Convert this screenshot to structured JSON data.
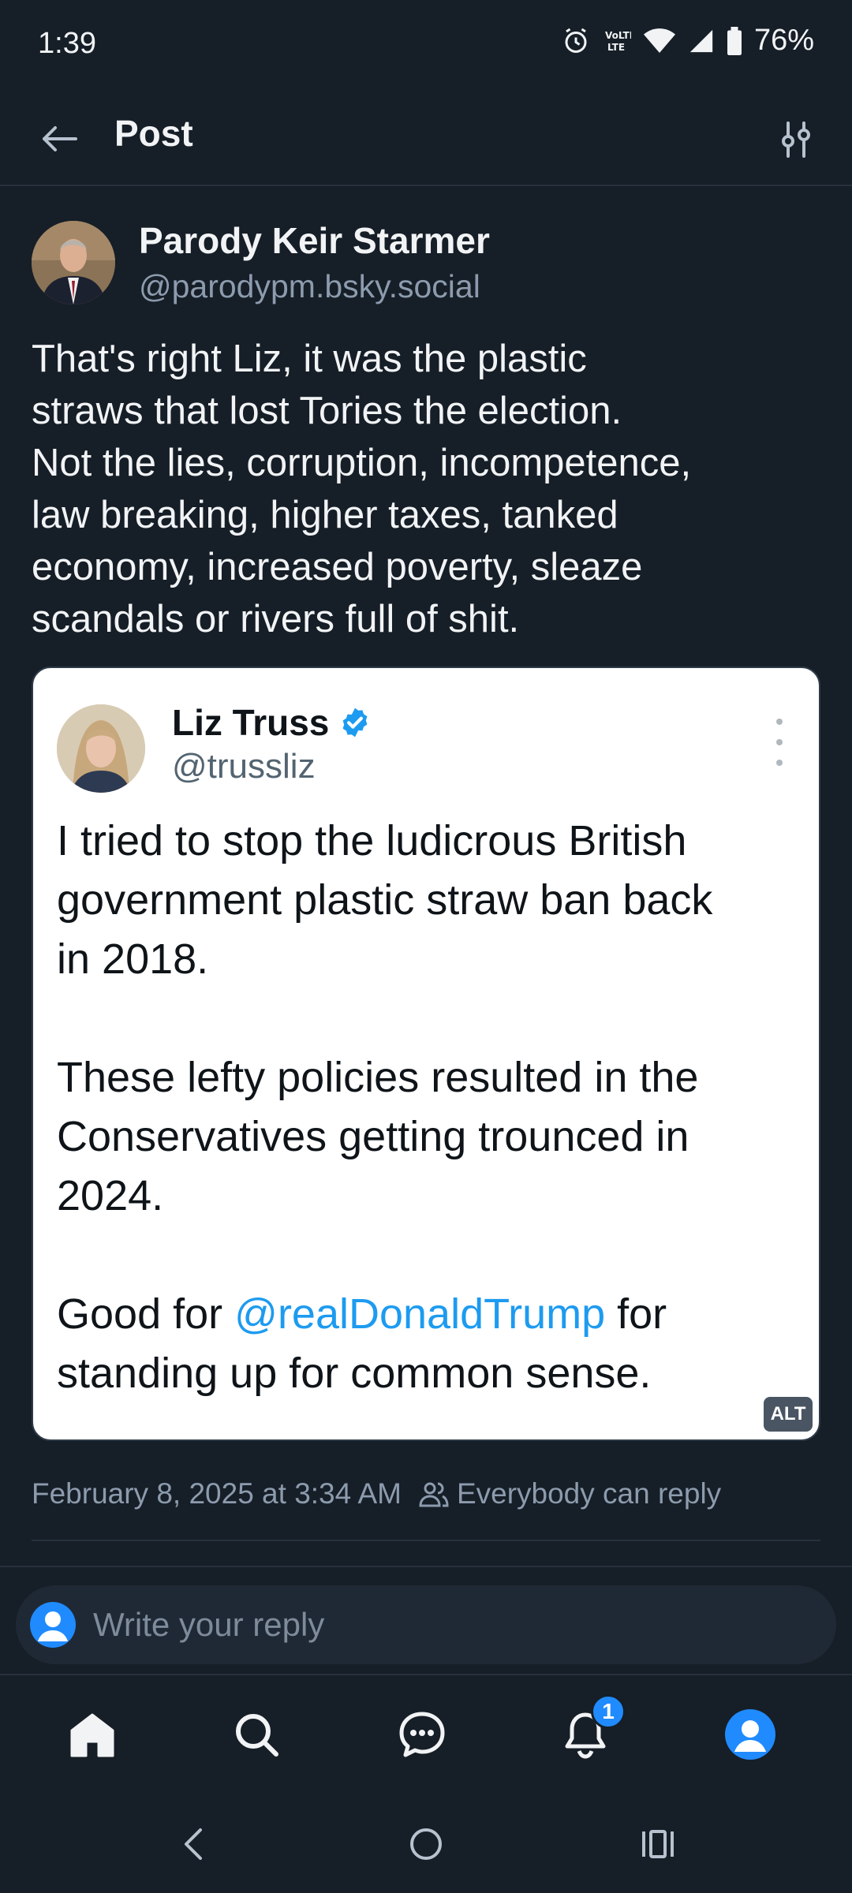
{
  "status_bar": {
    "time": "1:39",
    "battery": "76%"
  },
  "header": {
    "title": "Post"
  },
  "post": {
    "author_name": "Parody Keir Starmer",
    "author_handle": "@parodypm.bsky.social",
    "text_lines": [
      "That's right Liz, it was the plastic",
      "straws that lost Tories the election.",
      "Not the lies, corruption, incompetence,",
      "law breaking, higher taxes, tanked",
      "economy, increased poverty, sleaze",
      "scandals or rivers full of shit."
    ],
    "timestamp": "February 8, 2025 at 3:34 AM",
    "reply_setting": "Everybody can reply"
  },
  "embed": {
    "name": "Liz Truss",
    "handle": "@trussliz",
    "para1": [
      "I tried to stop the ludicrous British",
      "government plastic straw ban back",
      "in 2018."
    ],
    "para2": [
      "These lefty policies resulted in the",
      "Conservatives getting trounced in",
      "2024."
    ],
    "para3_prefix": "Good for ",
    "para3_mention": "@realDonaldTrump",
    "para3_suffix": " for",
    "para3_line2": "standing up for common sense.",
    "alt_label": "ALT"
  },
  "composer": {
    "placeholder": "Write your reply"
  },
  "nav": {
    "notifications_count": "1"
  },
  "colors": {
    "background": "#161e27",
    "accent": "#208bfe",
    "mention": "#1d9bf0",
    "muted": "#8c9bad"
  }
}
